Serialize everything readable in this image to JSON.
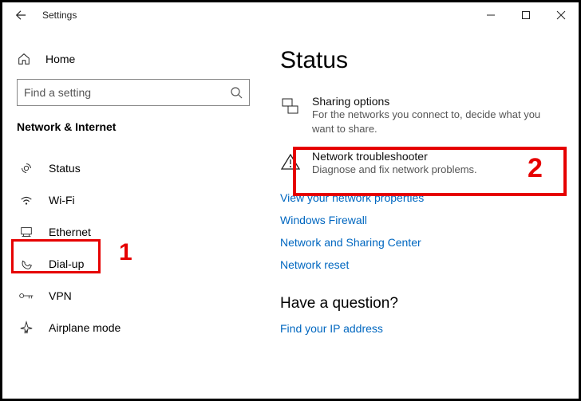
{
  "window": {
    "title": "Settings"
  },
  "sidebar": {
    "home_label": "Home",
    "search_placeholder": "Find a setting",
    "section_title": "Network & Internet",
    "items": [
      {
        "label": "Status"
      },
      {
        "label": "Wi-Fi"
      },
      {
        "label": "Ethernet"
      },
      {
        "label": "Dial-up"
      },
      {
        "label": "VPN"
      },
      {
        "label": "Airplane mode"
      }
    ]
  },
  "main": {
    "heading": "Status",
    "options": [
      {
        "title": "Sharing options",
        "sub": "For the networks you connect to, decide what you want to share."
      },
      {
        "title": "Network troubleshooter",
        "sub": "Diagnose and fix network problems."
      }
    ],
    "links": [
      "View your network properties",
      "Windows Firewall",
      "Network and Sharing Center",
      "Network reset"
    ],
    "question_heading": "Have a question?",
    "question_links": [
      "Find your IP address"
    ]
  },
  "annotations": {
    "num1": "1",
    "num2": "2"
  }
}
